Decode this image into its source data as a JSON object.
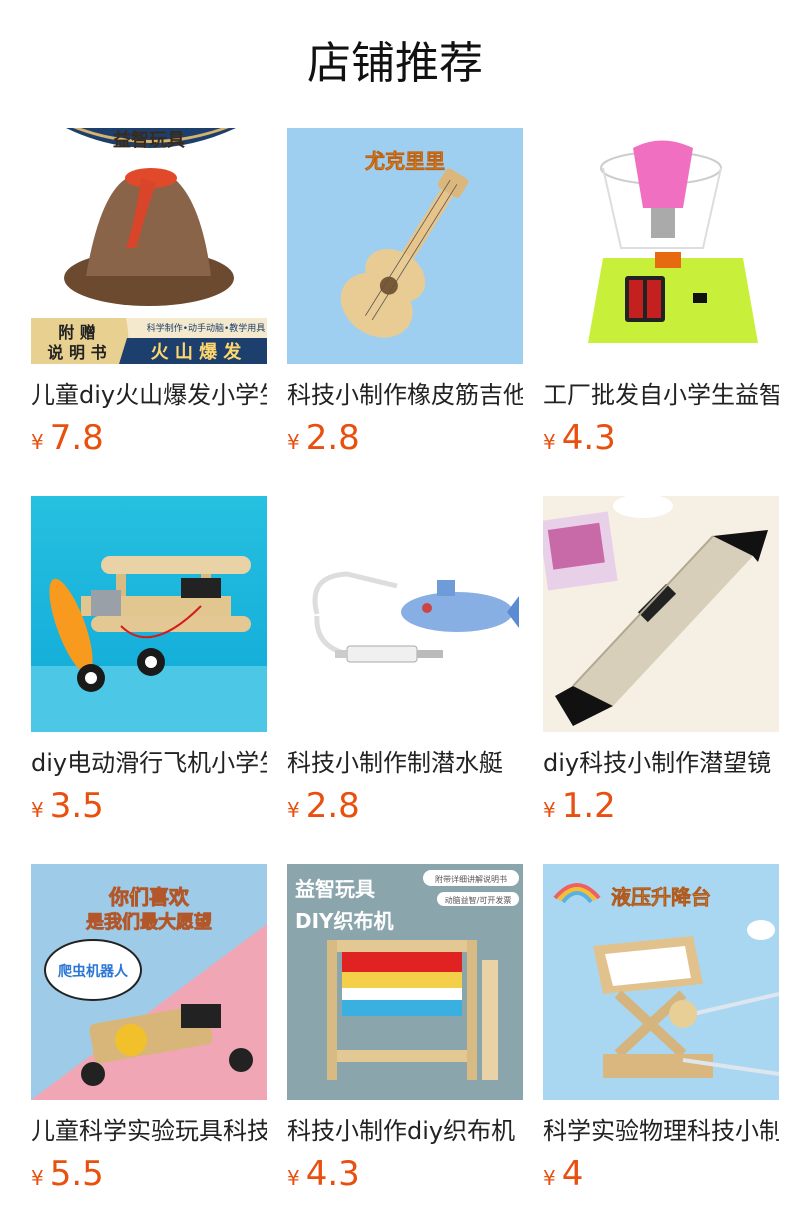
{
  "header": {
    "title": "店铺推荐"
  },
  "currency_symbol": "¥",
  "products": [
    {
      "title": "儿童diy火山爆发小学生科学实验",
      "price": "7.8",
      "image": {
        "banner_top": "益智玩具",
        "gift_line1": "附 赠",
        "gift_line2": "说 明 书",
        "tagline": "科学制作•动手动脑•教学用具",
        "label": "火 山 爆 发"
      }
    },
    {
      "title": "科技小制作橡皮筋吉他",
      "price": "2.8",
      "image": {
        "label": "尤克里里"
      }
    },
    {
      "title": "工厂批发自小学生益智",
      "price": "4.3",
      "image": {}
    },
    {
      "title": "diy电动滑行飞机小学生",
      "price": "3.5",
      "image": {}
    },
    {
      "title": "科技小制作制潜水艇",
      "price": "2.8",
      "image": {}
    },
    {
      "title": "diy科技小制作潜望镜",
      "price": "1.2",
      "image": {}
    },
    {
      "title": "儿童科学实验玩具科技",
      "price": "5.5",
      "image": {
        "bubble_line1": "你们喜欢",
        "bubble_line2": "是我们最大愿望",
        "speech": "爬虫机器人"
      }
    },
    {
      "title": "科技小制作diy织布机",
      "price": "4.3",
      "image": {
        "line1": "益智玩具",
        "line2": "DIY织布机",
        "tag1": "附带详细讲解说明书",
        "tag2": "动脑益智/可开发票"
      }
    },
    {
      "title": "科学实验物理科技小制作",
      "price": "4",
      "image": {
        "label": "液压升降台"
      }
    }
  ]
}
